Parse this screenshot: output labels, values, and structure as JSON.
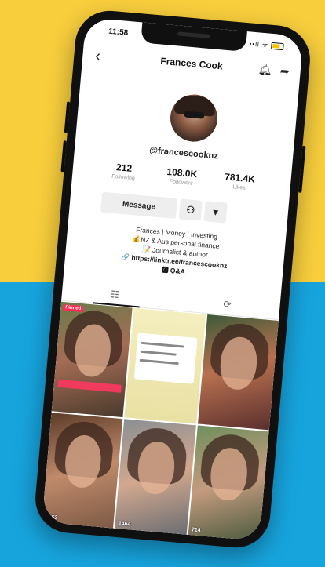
{
  "status_bar": {
    "time": "11:58",
    "icons": "••ll ᯤ"
  },
  "header": {
    "title": "Frances Cook",
    "back_icon": "chevron-left-icon",
    "bell_icon": "bell-icon",
    "share_icon": "share-icon"
  },
  "profile": {
    "handle": "@francescooknz",
    "stats": [
      {
        "value": "212",
        "label": "Following"
      },
      {
        "value": "108.0K",
        "label": "Followers"
      },
      {
        "value": "781.4K",
        "label": "Likes"
      }
    ],
    "buttons": {
      "message": "Message",
      "follow_icon": "person-icon",
      "more": "▾"
    },
    "bio": {
      "line1": "Frances | Money | Investing",
      "line2": "💰NZ & Aus personal finance",
      "line3": "📝 Journalist & author",
      "link": "🔗 https://linktr.ee/francescooknz",
      "qa": "🆀 Q&A"
    }
  },
  "tabs": [
    {
      "icon": "grid-icon",
      "glyph": "☷"
    },
    {
      "icon": "repost-icon",
      "glyph": "⟳"
    }
  ],
  "videos": [
    {
      "badge": "Pinned",
      "views": ""
    },
    {
      "badge": "",
      "views": ""
    },
    {
      "badge": "",
      "views": ""
    },
    {
      "badge": "",
      "views": "5053"
    },
    {
      "badge": "",
      "views": "1464"
    },
    {
      "badge": "",
      "views": "714"
    }
  ],
  "colors": {
    "yellow": "#f8ce3d",
    "blue": "#17a4dd",
    "accent": "#fe2c55"
  }
}
